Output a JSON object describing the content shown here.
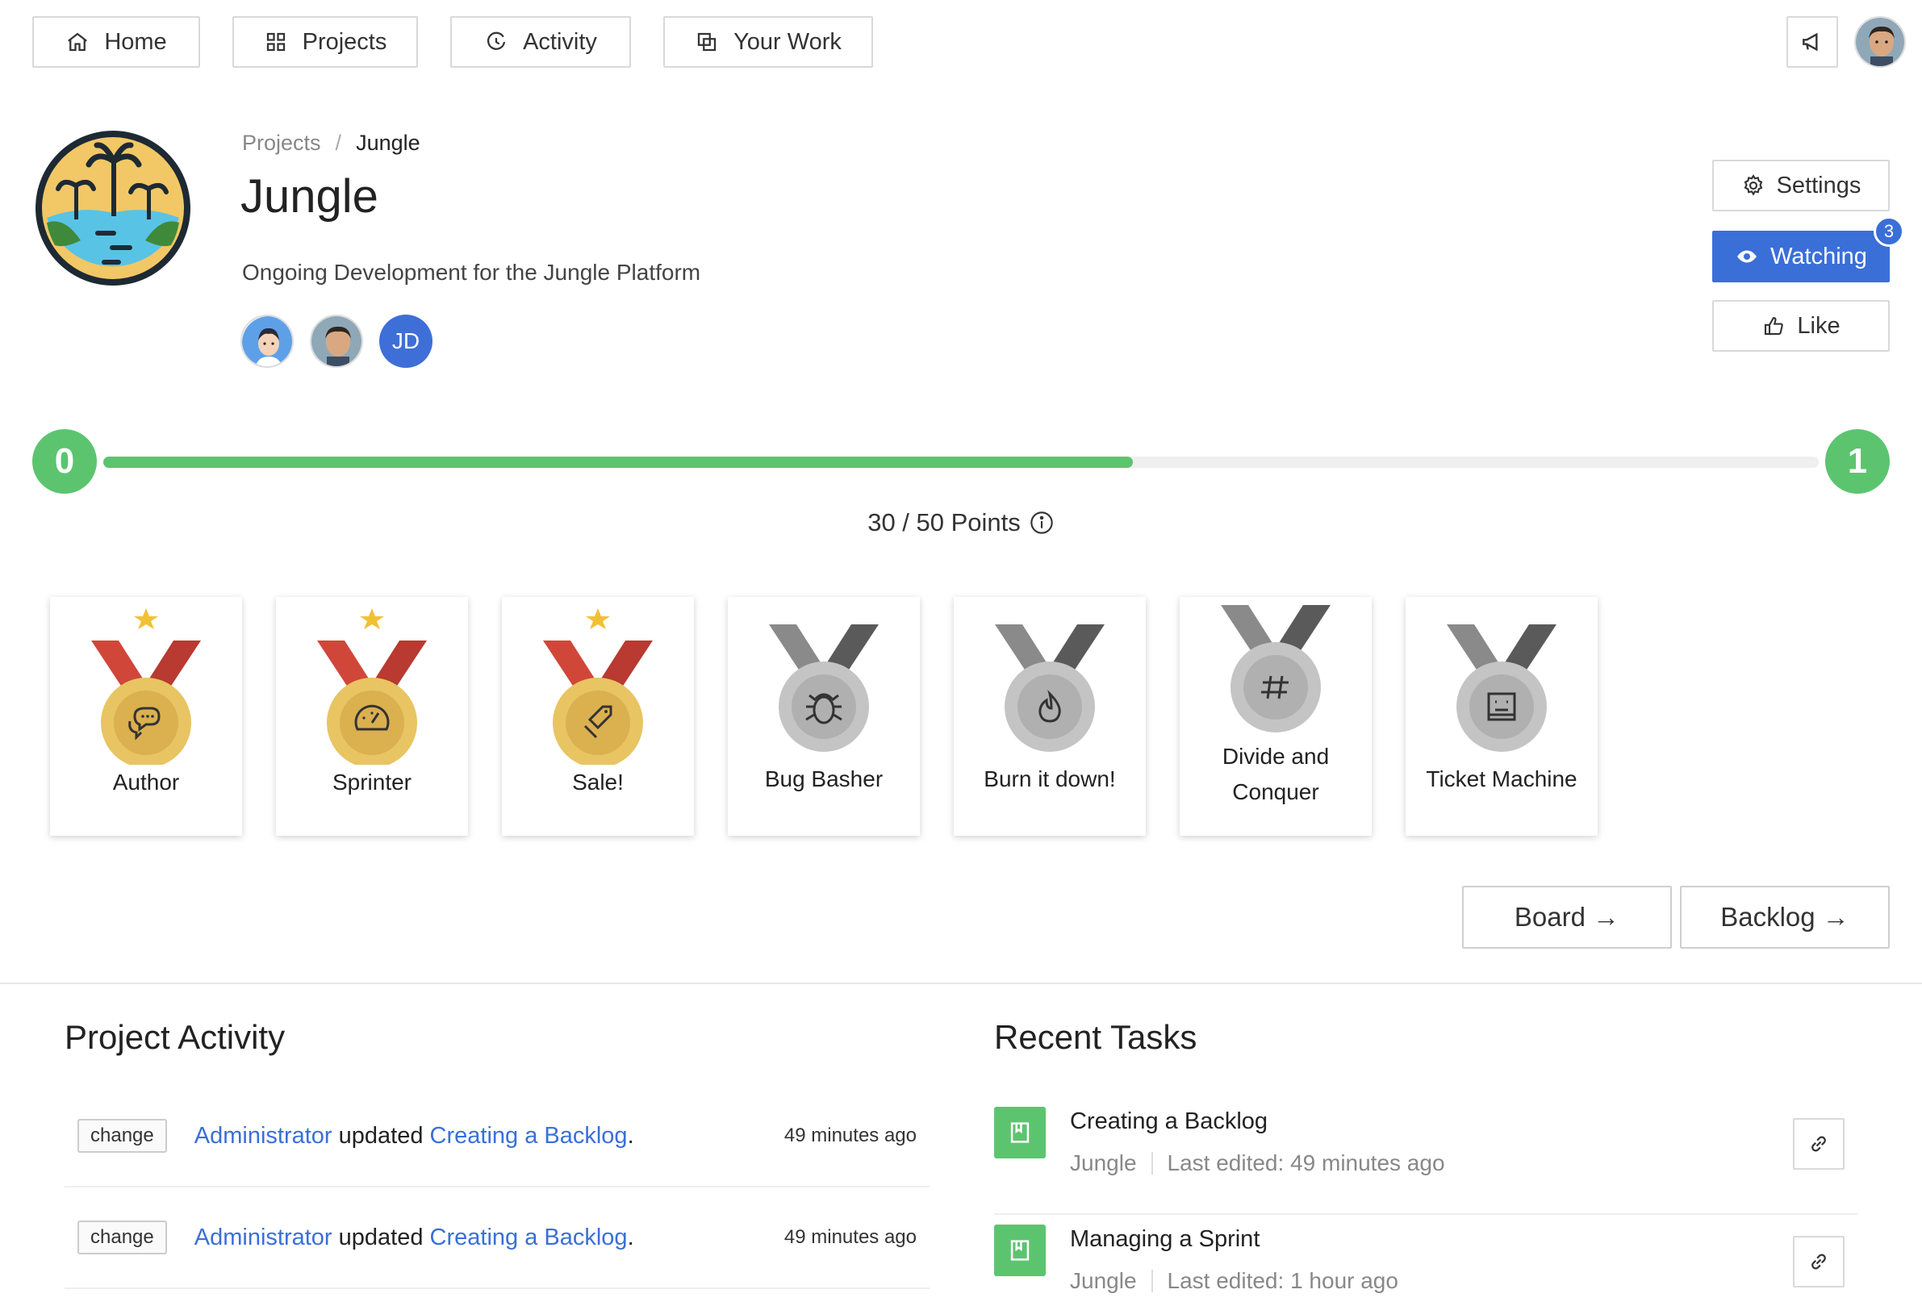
{
  "nav": {
    "items": [
      {
        "label": "Home",
        "icon": "home-icon"
      },
      {
        "label": "Projects",
        "icon": "grid-icon"
      },
      {
        "label": "Activity",
        "icon": "history-icon"
      },
      {
        "label": "Your Work",
        "icon": "copy-icon"
      }
    ],
    "announce_icon": "megaphone-icon"
  },
  "project": {
    "breadcrumb": {
      "parent": "Projects",
      "separator": "/",
      "current": "Jungle"
    },
    "title": "Jungle",
    "description": "Ongoing Development for the Jungle Platform",
    "members": [
      {
        "kind": "avatar-cartoon"
      },
      {
        "kind": "avatar-photo"
      },
      {
        "kind": "initials",
        "initials": "JD"
      }
    ]
  },
  "actions": {
    "settings_label": "Settings",
    "watching_label": "Watching",
    "watchers_count": "3",
    "like_label": "Like"
  },
  "progress": {
    "current_level": "0",
    "next_level": "1",
    "points_text": "30 / 50 Points",
    "fraction": 0.6,
    "color": "#5cc46f"
  },
  "badges": [
    {
      "label": "Author",
      "earned": true,
      "icon": "chat-icon"
    },
    {
      "label": "Sprinter",
      "earned": true,
      "icon": "speedometer-icon"
    },
    {
      "label": "Sale!",
      "earned": true,
      "icon": "tag-icon"
    },
    {
      "label": "Bug Basher",
      "earned": false,
      "icon": "bug-icon"
    },
    {
      "label": "Burn it down!",
      "earned": false,
      "icon": "flame-icon"
    },
    {
      "label_line1": "Divide and",
      "label_line2": "Conquer",
      "earned": false,
      "icon": "hash-icon"
    },
    {
      "label": "Ticket Machine",
      "earned": false,
      "icon": "ticket-icon"
    }
  ],
  "links": {
    "board_label": "Board →",
    "backlog_label": "Backlog →"
  },
  "activity": {
    "title": "Project Activity",
    "rows": [
      {
        "type": "change",
        "actor": "Administrator",
        "verb": "updated",
        "target": "Creating a Backlog",
        "end": ".",
        "time": "49 minutes ago"
      },
      {
        "type": "change",
        "actor": "Administrator",
        "verb": "updated",
        "target": "Creating a Backlog",
        "end": ".",
        "time": "49 minutes ago"
      }
    ]
  },
  "tasks": {
    "title": "Recent Tasks",
    "rows": [
      {
        "name": "Creating a Backlog",
        "project": "Jungle",
        "edited": "Last edited: 49 minutes ago"
      },
      {
        "name": "Managing a Sprint",
        "project": "Jungle",
        "edited": "Last edited: 1 hour ago"
      }
    ]
  },
  "colors": {
    "accent_blue": "#3a6fd8",
    "success_green": "#5cc46f",
    "gold": "#e8c462",
    "ribbon_red": "#c9473a",
    "silver": "#bdbdbd"
  }
}
